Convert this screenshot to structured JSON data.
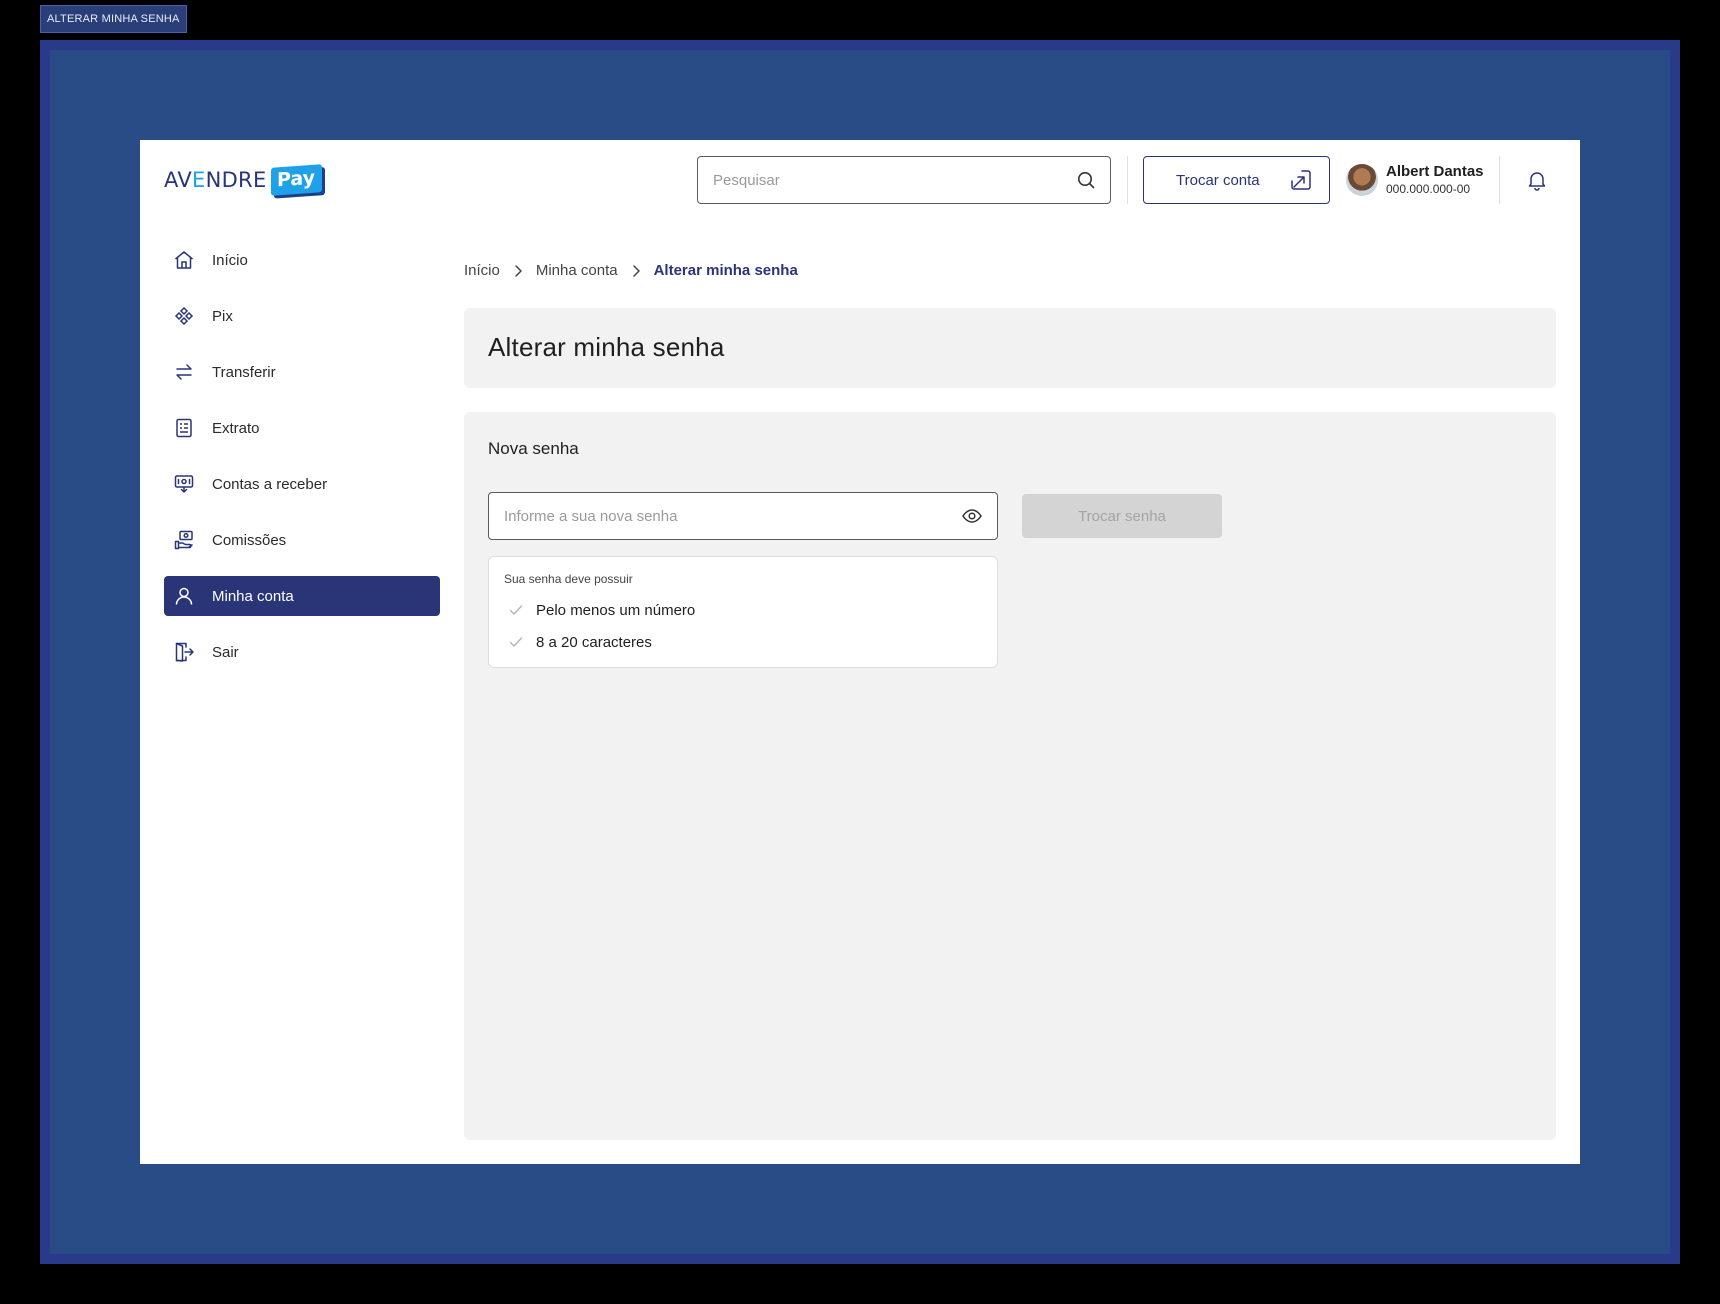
{
  "frame_tag": "ALTERAR MINHA SENHA",
  "brand": {
    "logo_prefix": "AV",
    "logo_e": "E",
    "logo_suffix": "NDRE",
    "logo_pay": "Pay",
    "accent": "#2a3578",
    "accent_light": "#1ea1e8"
  },
  "header": {
    "search": {
      "placeholder": "Pesquisar",
      "value": "",
      "icon": "search-icon"
    },
    "switch_account_label": "Trocar conta",
    "user": {
      "name": "Albert Dantas",
      "document": "000.000.000-00"
    },
    "notification_icon": "bell-icon"
  },
  "sidebar": {
    "items": [
      {
        "label": "Início",
        "icon": "home-icon",
        "active": false
      },
      {
        "label": "Pix",
        "icon": "pix-icon",
        "active": false
      },
      {
        "label": "Transferir",
        "icon": "transfer-arrows-icon",
        "active": false
      },
      {
        "label": "Extrato",
        "icon": "statement-icon",
        "active": false
      },
      {
        "label": "Contas a receber",
        "icon": "receivables-icon",
        "active": false
      },
      {
        "label": "Comissões",
        "icon": "commission-icon",
        "active": false
      },
      {
        "label": "Minha conta",
        "icon": "user-icon",
        "active": true
      },
      {
        "label": "Sair",
        "icon": "logout-icon",
        "active": false
      }
    ]
  },
  "breadcrumb": [
    "Início",
    "Minha conta",
    "Alterar minha senha"
  ],
  "page_title": "Alterar minha senha",
  "form": {
    "section_title": "Nova senha",
    "password_placeholder": "Informe a sua nova senha",
    "password_value": "",
    "submit_label": "Trocar senha",
    "submit_enabled": false,
    "rules_title": "Sua senha deve possuir",
    "rules": [
      "Pelo menos um número",
      "8 a 20 caracteres"
    ]
  }
}
